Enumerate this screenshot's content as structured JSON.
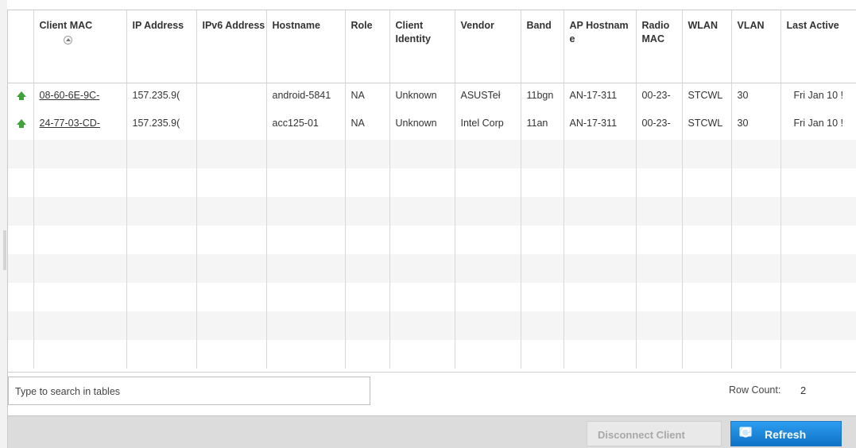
{
  "table": {
    "columns": [
      {
        "label": "Client MAC"
      },
      {
        "label": "IP Address"
      },
      {
        "label": "IPv6 Address"
      },
      {
        "label": "Hostname"
      },
      {
        "label": "Role"
      },
      {
        "label": "Client Identity"
      },
      {
        "label": "Vendor"
      },
      {
        "label": "Band"
      },
      {
        "label": "AP Hostnam e"
      },
      {
        "label": "Radio MAC"
      },
      {
        "label": "WLAN"
      },
      {
        "label": "VLAN"
      },
      {
        "label": "Last Active"
      }
    ],
    "rows": [
      {
        "client_mac": "08-60-6E-9C-",
        "ip": "157.235.9(",
        "ipv6": "",
        "hostname": "android-5841",
        "role": "NA",
        "identity": "Unknown",
        "vendor": "ASUSTeł",
        "band": "11bgn",
        "ap_hostname": "AN-17-311",
        "radio_mac": "00-23-",
        "wlan": "STCWL",
        "vlan": "30",
        "last_active": "Fri Jan 10 !"
      },
      {
        "client_mac": "24-77-03-CD-",
        "ip": "157.235.9(",
        "ipv6": "",
        "hostname": "acc125-01",
        "role": "NA",
        "identity": "Unknown",
        "vendor": "Intel Corp",
        "band": "11an",
        "ap_hostname": "AN-17-311",
        "radio_mac": "00-23-",
        "wlan": "STCWL",
        "vlan": "30",
        "last_active": "Fri Jan 10 !"
      }
    ],
    "status_icon": "green-up-arrow-icon"
  },
  "search": {
    "placeholder": "Type to search in tables"
  },
  "row_count": {
    "label": "Row Count:",
    "value": "2"
  },
  "actions": {
    "disconnect_label": "Disconnect Client",
    "refresh_label": "Refresh"
  },
  "colors": {
    "status_green": "#3fa33a",
    "refresh_blue": "#1683d8",
    "disabled_text": "#a8a8a8"
  }
}
